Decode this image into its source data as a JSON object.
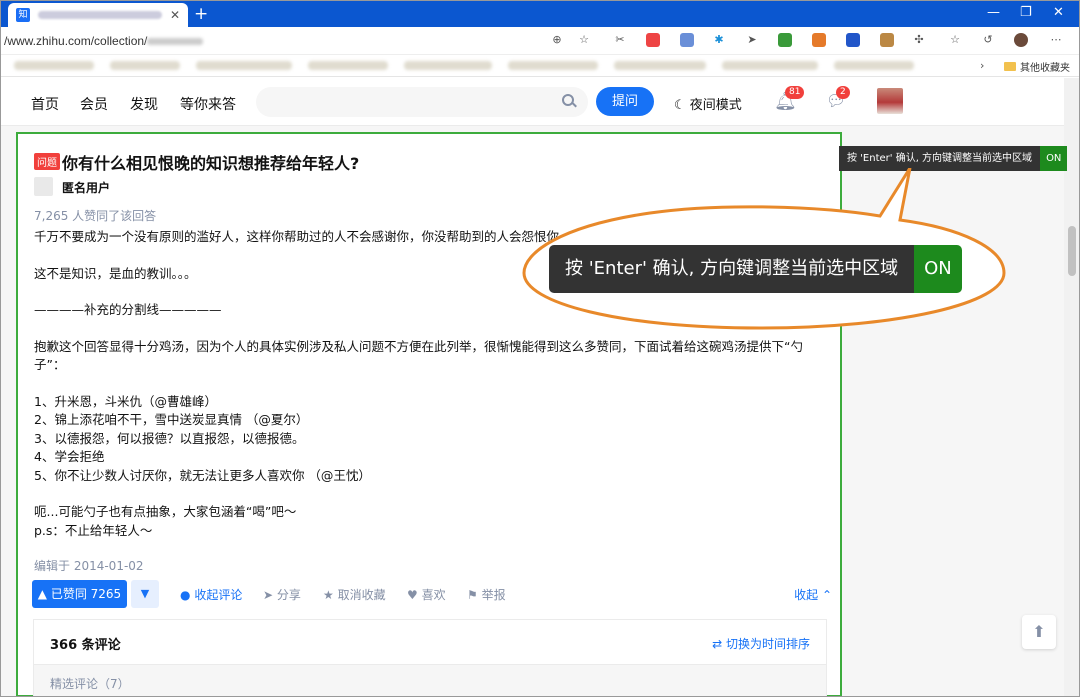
{
  "browser": {
    "tab_icon": "知",
    "url_prefix": "/www.zhihu.com/collection/",
    "bookmark_folder": "其他收藏夹"
  },
  "nav": {
    "home": "首页",
    "member": "会员",
    "discover": "发现",
    "waiting": "等你来答",
    "ask": "提问",
    "night_mode": "夜间模式",
    "notification_count": "81",
    "message_count": "2"
  },
  "question": {
    "tag": "问题",
    "title": "你有什么相见恨晚的知识想推荐给年轻人?",
    "author": "匿名用户",
    "votes_line": "7,265 人赞同了该回答"
  },
  "answer": {
    "p1": "千万不要成为一个没有原则的滥好人，这样你帮助过的人不会感谢你，你没帮助到的人会怨恨你。",
    "p2": "这不是知识，是血的教训。。。",
    "p3": "————补充的分割线—————",
    "p4": "抱歉这个回答显得十分鸡汤，因为个人的具体实例涉及私人问题不方便在此列举，很惭愧能得到这么多赞同，下面试着给这碗鸡汤提供下“勺子”：",
    "list": [
      "1、升米恩，斗米仇（@曹雄峰）",
      "2、锦上添花咱不干，雪中送炭显真情 （@夏尔）",
      "3、以德报怨，何以报德？以直报怨，以德报德。",
      "4、学会拒绝",
      "5、你不让少数人讨厌你，就无法让更多人喜欢你 （@王忱）"
    ],
    "p5": "呃...可能勺子也有点抽象，大家包涵着“喝”吧～",
    "p6": "p.s：不止给年轻人～",
    "edited": "编辑于 2014-01-02"
  },
  "actions": {
    "voted": "▲ 已赞同 7265",
    "vote_down": "▼",
    "comments": "收起评论",
    "share": "分享",
    "uncollect": "取消收藏",
    "like": "喜欢",
    "report": "举报",
    "collapse": "收起"
  },
  "comments": {
    "count": "366 条评论",
    "sort": "切换为时间排序",
    "featured": "精选评论（7）"
  },
  "tooltip": {
    "text": "按 'Enter' 确认, 方向键调整当前选中区域",
    "on": "ON"
  },
  "colors": {
    "brand_blue": "#1772f6",
    "selection_green": "#3dac3d",
    "callout_orange": "#e8892a",
    "browser_blue": "#0b57d0"
  }
}
